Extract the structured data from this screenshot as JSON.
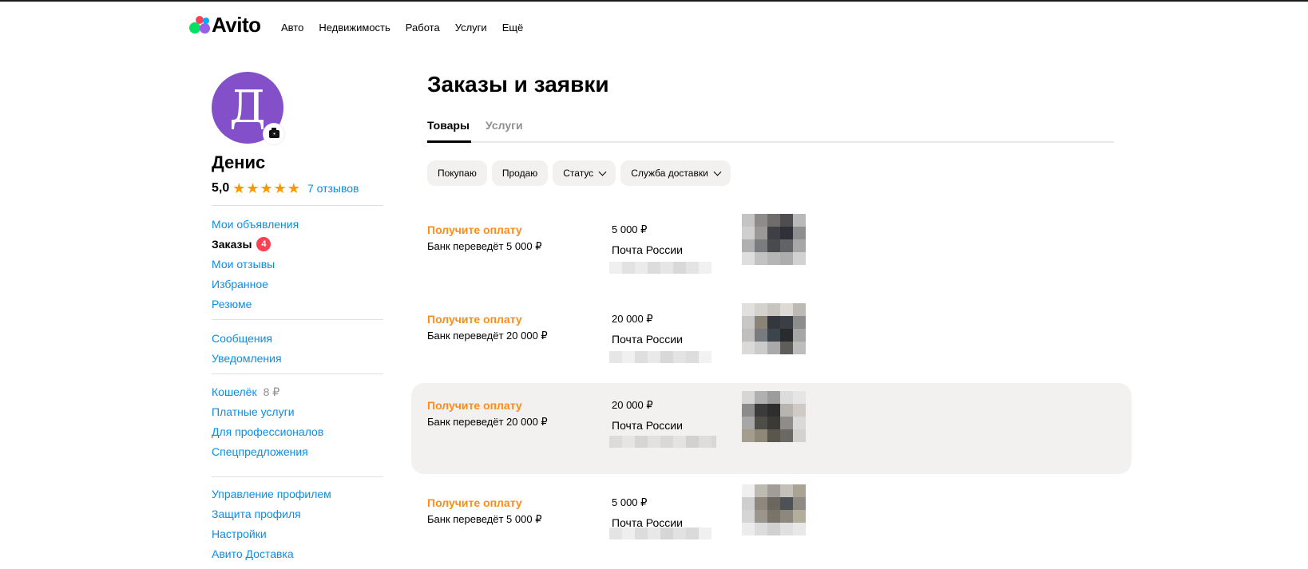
{
  "header": {
    "logo_text": "Avito",
    "logo_colors": [
      "#04e061",
      "#ff4053",
      "#965eeb",
      "#0af"
    ],
    "nav": [
      "Авто",
      "Недвижимость",
      "Работа",
      "Услуги",
      "Ещё"
    ]
  },
  "profile": {
    "avatar_letter": "Д",
    "avatar_color": "#8450c9",
    "name": "Денис",
    "rating": "5,0",
    "stars": "★★★★★",
    "star_count": 5,
    "reviews": "7 отзывов"
  },
  "sidebar": {
    "group1": [
      {
        "label": "Мои объявления"
      },
      {
        "label": "Заказы",
        "badge": "4",
        "active": true
      },
      {
        "label": "Мои отзывы"
      },
      {
        "label": "Избранное"
      },
      {
        "label": "Резюме"
      }
    ],
    "group2": [
      {
        "label": "Сообщения"
      },
      {
        "label": "Уведомления"
      }
    ],
    "group3": [
      {
        "label": "Кошелёк",
        "amount": "8 ₽"
      },
      {
        "label": "Платные услуги"
      },
      {
        "label": "Для профессионалов"
      },
      {
        "label": "Спецпредложения"
      }
    ],
    "group4": [
      {
        "label": "Управление профилем"
      },
      {
        "label": "Защита профиля"
      },
      {
        "label": "Настройки"
      },
      {
        "label": "Авито Доставка"
      }
    ]
  },
  "main": {
    "title": "Заказы и заявки",
    "tabs": [
      {
        "label": "Товары",
        "active": true
      },
      {
        "label": "Услуги",
        "active": false
      }
    ],
    "filters": [
      {
        "label": "Покупаю",
        "dropdown": false
      },
      {
        "label": "Продаю",
        "dropdown": false
      },
      {
        "label": "Статус",
        "dropdown": true
      },
      {
        "label": "Служба доставки",
        "dropdown": true
      }
    ],
    "orders": [
      {
        "status": "Получите оплату",
        "bank": "Банк переведёт 5 000 ₽",
        "price": "5 000 ₽",
        "delivery": "Почта России",
        "highlighted": false
      },
      {
        "status": "Получите оплату",
        "bank": "Банк переведёт 20 000 ₽",
        "price": "20 000 ₽",
        "delivery": "Почта России",
        "highlighted": false
      },
      {
        "status": "Получите оплату",
        "bank": "Банк переведёт 20 000 ₽",
        "price": "20 000 ₽",
        "delivery": "Почта России",
        "highlighted": true
      },
      {
        "status": "Получите оплату",
        "bank": "Банк переведёт 5 000 ₽",
        "price": "5 000 ₽",
        "delivery": "Почта России",
        "highlighted": false
      }
    ]
  },
  "colors": {
    "accent_link": "#0a8ee5",
    "status_orange": "#ff8c1a",
    "badge_red": "#ff4053",
    "star_orange": "#ff9800",
    "chip_bg": "#f2f1f0"
  }
}
